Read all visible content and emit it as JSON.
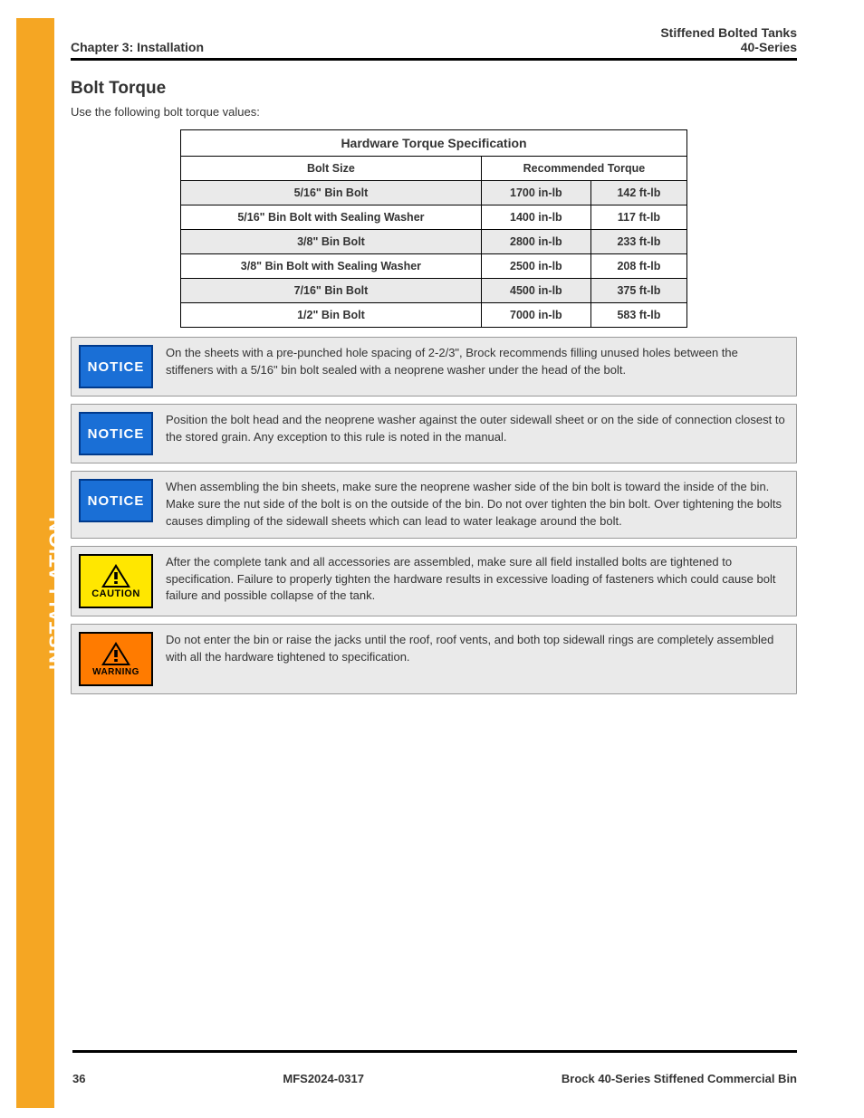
{
  "sidebar": {
    "label": "INSTALLATION"
  },
  "header": {
    "left": "Chapter 3: Installation",
    "right_line1": "Stiffened Bolted Tanks",
    "right_line2": "40-Series"
  },
  "section": {
    "title": "Bolt Torque",
    "intro": "Use the following bolt torque values:",
    "table": {
      "title": "Hardware Torque Specification",
      "sub_left": "Bolt Size",
      "sub_right": "Recommended Torque",
      "rows": [
        {
          "a": "5/16\" Bin Bolt",
          "b": "1700 in-lb",
          "c": "142 ft-lb",
          "shaded": true
        },
        {
          "a": "5/16\" Bin Bolt with Sealing Washer",
          "b": "1400 in-lb",
          "c": "117 ft-lb",
          "shaded": false
        },
        {
          "a": "3/8\" Bin Bolt",
          "b": "2800 in-lb",
          "c": "233 ft-lb",
          "shaded": true
        },
        {
          "a": "3/8\" Bin Bolt with Sealing Washer",
          "b": "2500 in-lb",
          "c": "208 ft-lb",
          "shaded": false
        },
        {
          "a": "7/16\" Bin Bolt",
          "b": "4500 in-lb",
          "c": "375 ft-lb",
          "shaded": true
        },
        {
          "a": "1/2\" Bin Bolt",
          "b": "7000 in-lb",
          "c": "583 ft-lb",
          "shaded": false
        }
      ]
    }
  },
  "callouts": [
    {
      "type": "notice",
      "text": "On the sheets with a pre-punched hole spacing of 2-2/3\", Brock recommends filling unused holes between the stiffeners with a 5/16\" bin bolt sealed with a neoprene washer under the head of the bolt."
    },
    {
      "type": "notice",
      "text": "Position the bolt head and the neoprene washer against the outer sidewall sheet or on the side of connection closest to the stored grain. Any exception to this rule is noted in the manual."
    },
    {
      "type": "notice",
      "text": "When assembling the bin sheets, make sure the neoprene washer side of the bin bolt is toward the inside of the bin. Make sure the nut side of the bolt is on the outside of the bin. Do not over tighten the bin bolt. Over tightening the bolts causes dimpling of the sidewall sheets which can lead to water leakage around the bolt."
    },
    {
      "type": "caution",
      "text": "After the complete tank and all accessories are assembled, make sure all field installed bolts are tightened to specification. Failure to properly tighten the hardware results in excessive loading of fasteners which could cause bolt failure and possible collapse of the tank."
    },
    {
      "type": "warning",
      "text": "Do not enter the bin or raise the jacks until the roof, roof vents, and both top sidewall rings are completely assembled with all the hardware tightened to specification."
    }
  ],
  "badges": {
    "notice": "NOTICE",
    "caution": "CAUTION",
    "warning": "WARNING"
  },
  "footer": {
    "page": "36",
    "doc_id": "MFS2024-0317",
    "rev": "Brock 40-Series Stiffened Commercial Bin"
  }
}
